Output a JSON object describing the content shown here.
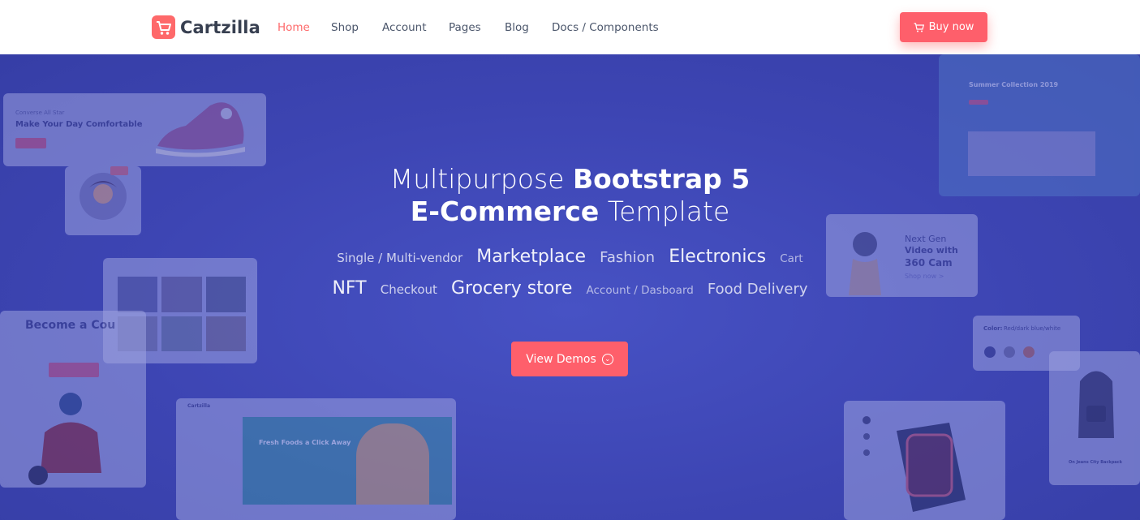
{
  "brand": {
    "name": "Cartzilla",
    "color": "#fe696a"
  },
  "nav": {
    "items": [
      {
        "label": "Home",
        "active": true
      },
      {
        "label": "Shop",
        "active": false
      },
      {
        "label": "Account",
        "active": false
      },
      {
        "label": "Pages",
        "active": false
      },
      {
        "label": "Blog",
        "active": false
      },
      {
        "label": "Docs / Components",
        "active": false
      }
    ],
    "buy_label": "Buy now"
  },
  "hero": {
    "title_line1_light": "Multipurpose ",
    "title_line1_bold": "Bootstrap 5",
    "title_line2_bold": "E-Commerce",
    "title_line2_light": " Template",
    "tags_row1": [
      "Single / Multi-vendor",
      "Marketplace",
      "Fashion",
      "Electronics",
      "Cart"
    ],
    "tags_row2": [
      "NFT",
      "Checkout",
      "Grocery store",
      "Account / Dasboard",
      "Food Delivery"
    ],
    "cta_label": "View Demos"
  },
  "preview_cards": {
    "comfort_title": "Make Your Day Comfortable",
    "comfort_kicker": "Converse All Star",
    "courier_title": "Become a Cou",
    "summer_title": "Summer Collection 2019",
    "video_line1": "Next Gen",
    "video_line2": "Video with",
    "video_line3": "360 Cam",
    "video_link": "Shop now >",
    "color_label": "Color:",
    "color_value": "Red/dark blue/white",
    "grocery_headline": "Fresh Foods a Click Away",
    "grocery_logo": "Cartzilla",
    "backpack_name": "On Jeans City Backpack"
  },
  "colors": {
    "accent": "#fe696a",
    "hero_bg": "#3c43b0",
    "nav_text": "#4b566b"
  }
}
